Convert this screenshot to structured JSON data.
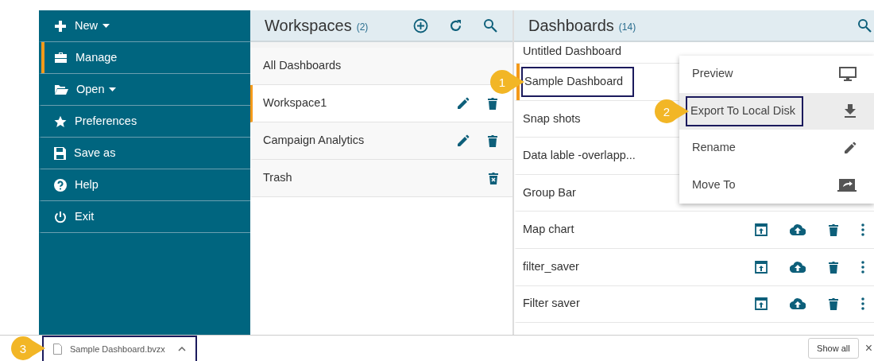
{
  "sidebar": {
    "items": [
      {
        "label": "New",
        "has_menu": true,
        "selected": false
      },
      {
        "label": "Manage",
        "has_menu": false,
        "selected": true
      },
      {
        "label": "Open",
        "has_menu": true,
        "selected": false
      },
      {
        "label": "Preferences",
        "has_menu": false,
        "selected": false
      },
      {
        "label": "Save as",
        "has_menu": false,
        "selected": false
      },
      {
        "label": "Help",
        "has_menu": false,
        "selected": false
      },
      {
        "label": "Exit",
        "has_menu": false,
        "selected": false
      }
    ]
  },
  "workspaces": {
    "title": "Workspaces",
    "count": "(2)",
    "items": [
      {
        "label": "All Dashboards",
        "kind": "all",
        "selected": false
      },
      {
        "label": "Workspace1",
        "kind": "workspace",
        "selected": true
      },
      {
        "label": "Campaign Analytics",
        "kind": "workspace",
        "selected": false
      },
      {
        "label": "Trash",
        "kind": "trash",
        "selected": false
      }
    ]
  },
  "dashboards": {
    "title": "Dashboards",
    "count": "(14)",
    "items": [
      {
        "label": "Untitled Dashboard",
        "selected": false
      },
      {
        "label": "Sample Dashboard",
        "selected": true,
        "callout": "1"
      },
      {
        "label": "Snap shots",
        "selected": false
      },
      {
        "label": "Data lable -overlapp...",
        "selected": false
      },
      {
        "label": "Group Bar",
        "selected": false
      },
      {
        "label": "Map chart",
        "selected": false
      },
      {
        "label": "filter_saver",
        "selected": false
      },
      {
        "label": "Filter saver",
        "selected": false
      }
    ]
  },
  "context_menu": {
    "items": [
      {
        "label": "Preview",
        "highlighted": false
      },
      {
        "label": "Export To Local Disk",
        "highlighted": true,
        "callout": "2"
      },
      {
        "label": "Rename",
        "highlighted": false
      },
      {
        "label": "Move To",
        "highlighted": false
      }
    ]
  },
  "download_bar": {
    "file": "Sample Dashboard.bvzx",
    "callout": "3",
    "show_all": "Show all",
    "close": "×"
  }
}
